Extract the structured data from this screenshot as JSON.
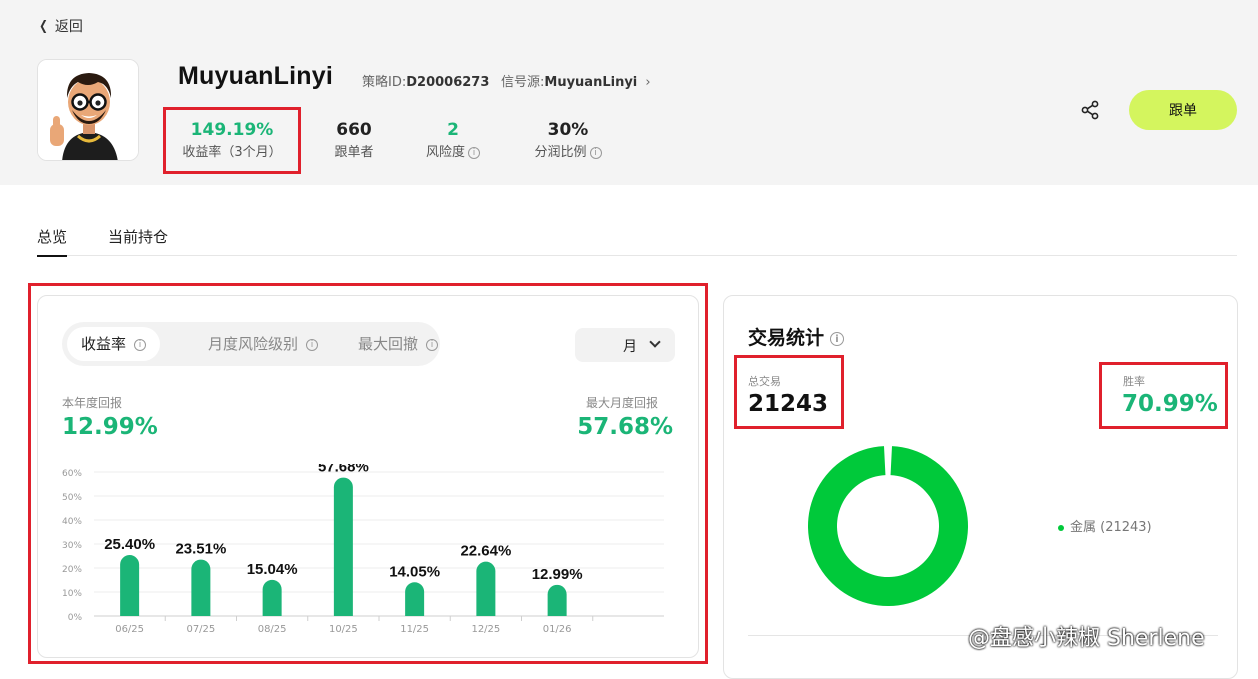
{
  "nav": {
    "back_label": "返回"
  },
  "profile": {
    "name": "MuyuanLinyi",
    "strategy_id_label": "策略ID:",
    "strategy_id": "D20006273",
    "signal_source_label": "信号源:",
    "signal_source": "MuyuanLinyi",
    "stats": [
      {
        "value": "149.19%",
        "label": "收益率（3个月）",
        "accent": true,
        "info": false
      },
      {
        "value": "660",
        "label": "跟单者",
        "accent": false,
        "info": false
      },
      {
        "value": "2",
        "label": "风险度",
        "accent": true,
        "info": true
      },
      {
        "value": "30%",
        "label": "分润比例",
        "accent": false,
        "info": true
      }
    ],
    "follow_label": "跟单"
  },
  "tabs": [
    {
      "label": "总览",
      "active": true
    },
    {
      "label": "当前持仓",
      "active": false
    }
  ],
  "perf": {
    "segments": [
      {
        "label": "收益率",
        "active": true
      },
      {
        "label": "月度风险级别",
        "active": false
      },
      {
        "label": "最大回撤",
        "active": false
      }
    ],
    "period_value": "月",
    "ytd_label": "本年度回报",
    "ytd_value": "12.99%",
    "max_month_label": "最大月度回报",
    "max_month_value": "57.68%"
  },
  "chart_data": {
    "type": "bar",
    "categories": [
      "06/25",
      "07/25",
      "08/25",
      "10/25",
      "11/25",
      "12/25",
      "01/26"
    ],
    "values": [
      25.4,
      23.51,
      15.04,
      57.68,
      14.05,
      22.64,
      12.99
    ],
    "data_labels": [
      "25.40%",
      "23.51%",
      "15.04%",
      "57.68%",
      "14.05%",
      "22.64%",
      "12.99%"
    ],
    "yticks": [
      "0%",
      "10%",
      "20%",
      "30%",
      "40%",
      "50%",
      "60%"
    ],
    "ylim": [
      0,
      60
    ],
    "grid": true,
    "title": "",
    "xlabel": "",
    "ylabel": "",
    "bar_color": "#1bb577"
  },
  "trade_stats": {
    "title": "交易统计",
    "total_label": "总交易",
    "total_value": "21243",
    "winrate_label": "胜率",
    "winrate_value": "70.99%",
    "legend_label": "金属 (21243)",
    "donut_color": "#00c93a",
    "donut_fraction": 1.0
  },
  "watermark": "@盘感小辣椒 Sherlene",
  "colors": {
    "accent_green": "#1bb577",
    "highlight_red": "#e0202c",
    "follow_button": "#d4f55e"
  }
}
